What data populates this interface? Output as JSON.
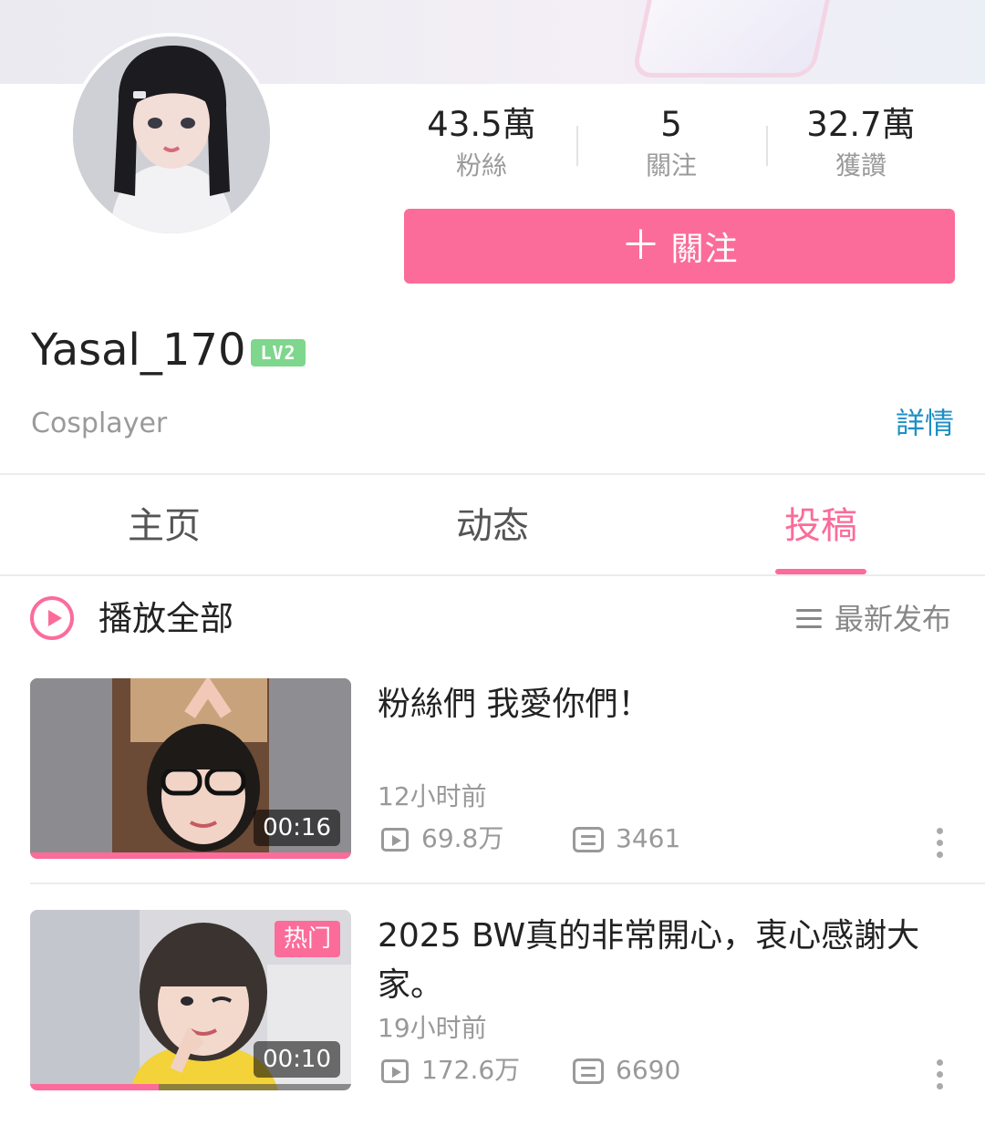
{
  "profile": {
    "username": "Yasal_170",
    "level_badge": "LV2",
    "bio": "Cosplayer",
    "details_label": "詳情"
  },
  "stats": [
    {
      "value": "43.5萬",
      "label": "粉絲"
    },
    {
      "value": "5",
      "label": "關注"
    },
    {
      "value": "32.7萬",
      "label": "獲讚"
    }
  ],
  "follow_button": {
    "icon": "plus-icon",
    "label": "關注"
  },
  "tabs": [
    {
      "label": "主页",
      "active": false
    },
    {
      "label": "动态",
      "active": false
    },
    {
      "label": "投稿",
      "active": true
    }
  ],
  "toolbar": {
    "play_all_label": "播放全部",
    "sort_label": "最新发布"
  },
  "videos": [
    {
      "title": "粉絲們 我愛你們！",
      "time": "12小时前",
      "views": "69.8万",
      "comments": "3461",
      "duration": "00:16",
      "hot_tag": null,
      "watched_progress": 1.0
    },
    {
      "title": "2025 BW真的非常開心，衷心感謝大家。",
      "time": "19小时前",
      "views": "172.6万",
      "comments": "6690",
      "duration": "00:10",
      "hot_tag": "热门",
      "watched_progress": 0.4
    }
  ],
  "colors": {
    "accent": "#fb6c9a",
    "link": "#1e8fc6",
    "level_badge": "#7fd68d"
  }
}
